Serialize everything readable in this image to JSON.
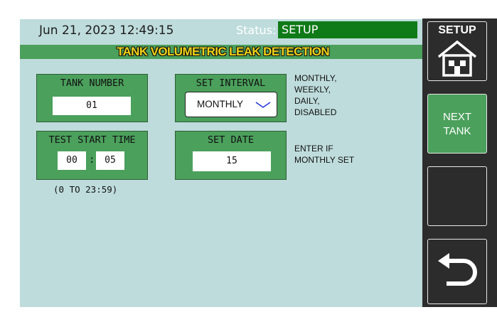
{
  "header": {
    "datetime": "Jun 21, 2023 12:49:15",
    "status_label": "Status:",
    "status_value": "SETUP"
  },
  "title": "TANK VOLUMETRIC LEAK DETECTION",
  "tank_number": {
    "label": "TANK NUMBER",
    "value": "01"
  },
  "test_start_time": {
    "label": "TEST START TIME",
    "hours": "00",
    "separator": ":",
    "minutes": "05",
    "range": "(0 TO 23:59)"
  },
  "set_interval": {
    "label": "SET INTERVAL",
    "selected": "MONTHLY",
    "icon": "chevron-down-icon",
    "options_hint": [
      "MONTHLY,",
      "WEEKLY,",
      "DAILY,",
      "DISABLED"
    ]
  },
  "set_date": {
    "label": "SET DATE",
    "value": "15",
    "hint": [
      "ENTER IF",
      "MONTHLY SET"
    ]
  },
  "sidebar": {
    "setup_label": "SETUP",
    "setup_icon": "home-icon",
    "next_tank_label": [
      "NEXT",
      "TANK"
    ],
    "back_icon": "back-arrow-icon"
  },
  "colors": {
    "screen_bg": "#bfdcdc",
    "panel_green": "#4ba05c",
    "status_green": "#0e7a18",
    "title_text": "#f1d317",
    "sidebar_bg": "#2c2c2c"
  }
}
